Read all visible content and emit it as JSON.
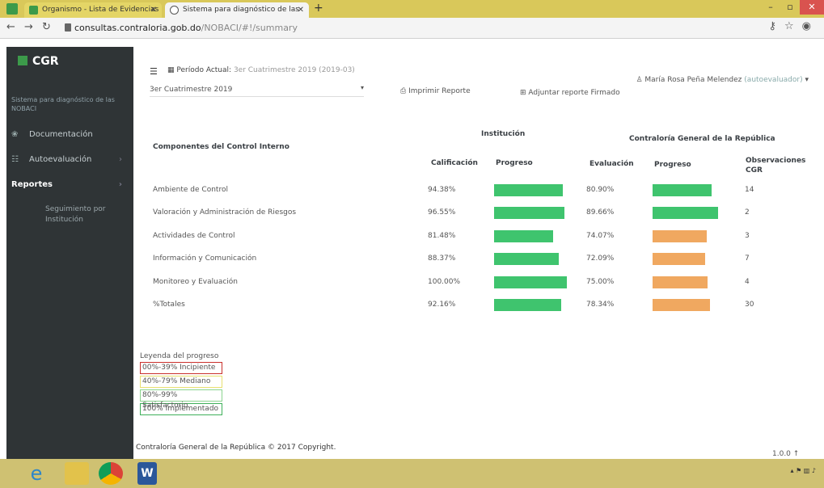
{
  "browser": {
    "tabs": [
      {
        "label": "Organismo - Lista de Evidencias"
      },
      {
        "label": "Sistema para diagnóstico de las"
      }
    ],
    "url_host": "consultas.contraloria.gob.do",
    "url_path": "/NOBACI/#!/summary"
  },
  "sidebar": {
    "brand": "CGR",
    "subtitle": "Sistema para diagnóstico de las NOBACI",
    "items": [
      {
        "label": "Documentación"
      },
      {
        "label": "Autoevaluación"
      },
      {
        "label": "Reportes"
      }
    ],
    "subitem": "Seguimiento por Institución"
  },
  "header": {
    "periodo_label": "Período Actual:",
    "periodo_value": "3er Cuatrimestre 2019 (2019-03)",
    "user_name": "María Rosa Peña Melendez",
    "user_role": "(autoevaluador)",
    "selector_value": "3er Cuatrimestre 2019",
    "print_label": "Imprimir Reporte",
    "attach_label": "Adjuntar reporte Firmado"
  },
  "table": {
    "group_institucion": "Institución",
    "group_cgr": "Contraloría General de la República",
    "col_componentes": "Componentes del Control Interno",
    "col_calificacion": "Calificación",
    "col_progreso1": "Progreso",
    "col_evaluacion": "Evaluación",
    "col_progreso2": "Progreso",
    "col_observaciones": "Observaciones CGR",
    "rows": [
      {
        "name": "Ambiente de Control",
        "calificacion": "94.38%",
        "cal_value": 94.38,
        "evaluacion": "80.90%",
        "eval_value": 80.9,
        "eval_color": "green",
        "obs": "14"
      },
      {
        "name": "Valoración y Administración de Riesgos",
        "calificacion": "96.55%",
        "cal_value": 96.55,
        "evaluacion": "89.66%",
        "eval_value": 89.66,
        "eval_color": "green",
        "obs": "2"
      },
      {
        "name": "Actividades de Control",
        "calificacion": "81.48%",
        "cal_value": 81.48,
        "evaluacion": "74.07%",
        "eval_value": 74.07,
        "eval_color": "orange",
        "obs": "3"
      },
      {
        "name": "Información y Comunicación",
        "calificacion": "88.37%",
        "cal_value": 88.37,
        "evaluacion": "72.09%",
        "eval_value": 72.09,
        "eval_color": "orange",
        "obs": "7"
      },
      {
        "name": "Monitoreo y Evaluación",
        "calificacion": "100.00%",
        "cal_value": 100.0,
        "evaluacion": "75.00%",
        "eval_value": 75.0,
        "eval_color": "orange",
        "obs": "4"
      },
      {
        "name": "%Totales",
        "calificacion": "92.16%",
        "cal_value": 92.16,
        "evaluacion": "78.34%",
        "eval_value": 78.34,
        "eval_color": "orange",
        "obs": "30"
      }
    ]
  },
  "legend": {
    "title": "Leyenda del progreso",
    "items": [
      {
        "label": "00%-39% Incipiente"
      },
      {
        "label": "40%-79% Mediano"
      },
      {
        "label": "80%-99% Satisfactorio"
      },
      {
        "label": "100% Implementado"
      }
    ]
  },
  "footer": {
    "copyright": "Contraloría General de la República © 2017 Copyright.",
    "version": "1.0.0"
  },
  "colors": {
    "green": "#3fc46e",
    "orange": "#f0a860",
    "sidebar": "#2f3436"
  }
}
